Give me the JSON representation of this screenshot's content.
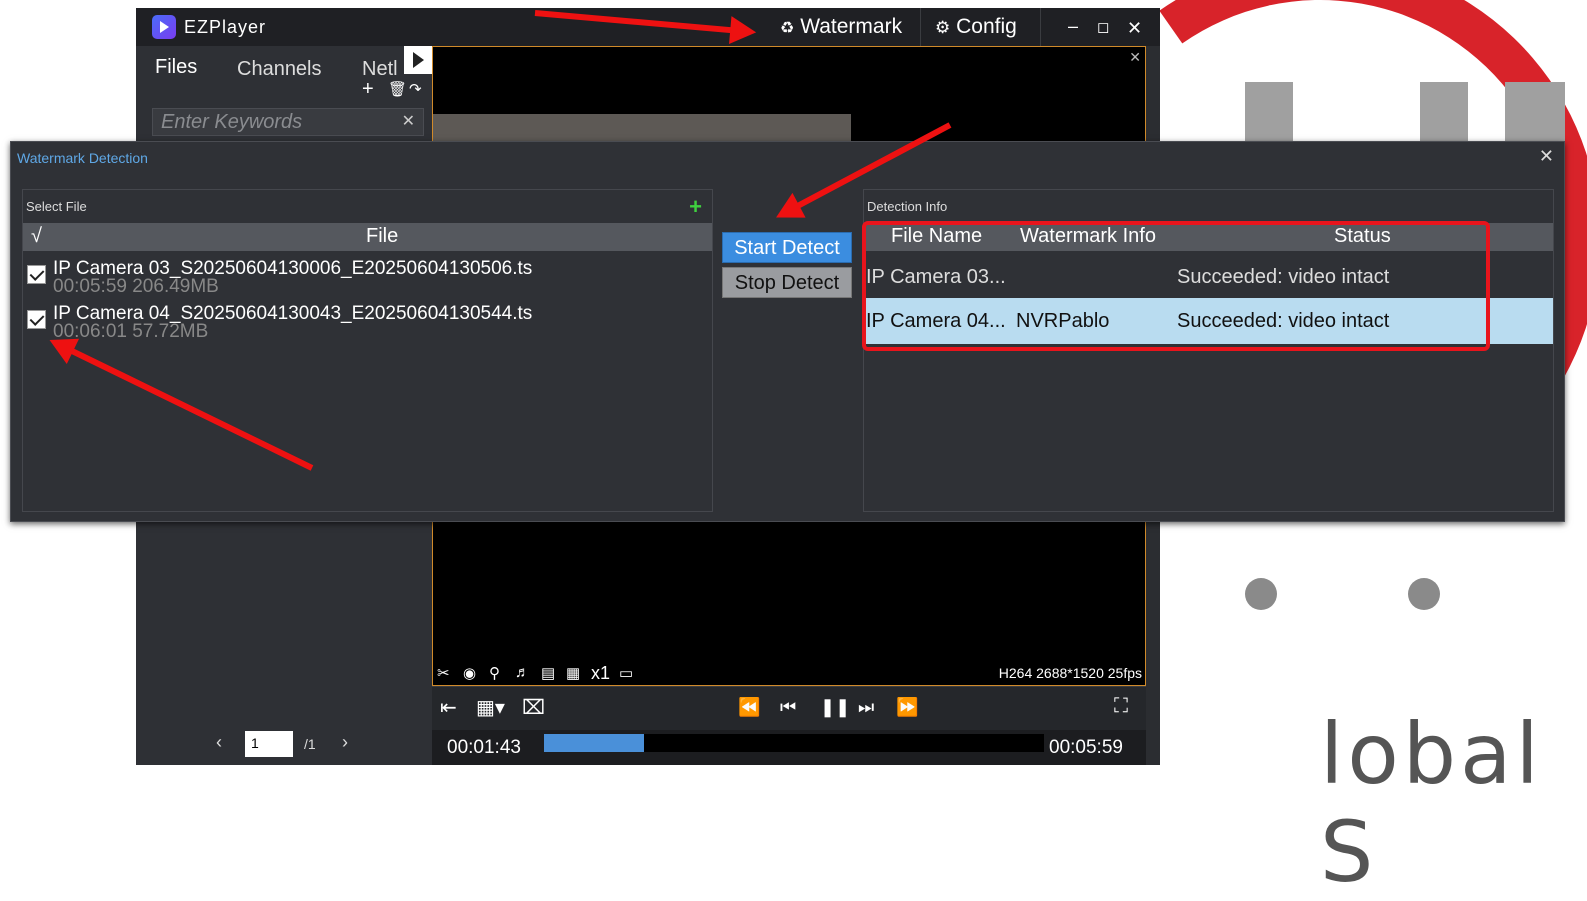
{
  "app": {
    "title": "EZPlayer",
    "watermark_label": "Watermark",
    "config_label": "Config",
    "tabs": [
      "Files",
      "Channels",
      "Netl"
    ],
    "keyword_placeholder": "Enter Keywords",
    "video_info": "H264 2688*1520 25fps",
    "speed": "x1",
    "time_current": "00:01:43",
    "time_total": "00:05:59",
    "progress": 0.2,
    "page_current": "1",
    "page_total": "/1"
  },
  "dialog": {
    "title": "Watermark Detection",
    "select_file_title": "Select File",
    "file_header_check": "√",
    "file_header": "File",
    "files": [
      {
        "name": "IP Camera 03_S20250604130006_E20250604130506.ts",
        "meta": "00:05:59   206.49MB",
        "checked": true
      },
      {
        "name": "IP Camera 04_S20250604130043_E20250604130544.ts",
        "meta": "00:06:01   57.72MB",
        "checked": true
      }
    ],
    "start_label": "Start Detect",
    "stop_label": "Stop Detect",
    "detection_title": "Detection Info",
    "columns": [
      "File Name",
      "Watermark Info",
      "Status"
    ],
    "rows": [
      {
        "file": "IP Camera 03...",
        "watermark": "",
        "status": "Succeeded: video intact"
      },
      {
        "file": "IP Camera 04...",
        "watermark": "NVRPablo",
        "status": "Succeeded: video intact"
      }
    ]
  },
  "colors": {
    "accent_blue": "#3b8de0",
    "selected_row": "#b9dcf0",
    "annotation_red": "#e8141c"
  }
}
